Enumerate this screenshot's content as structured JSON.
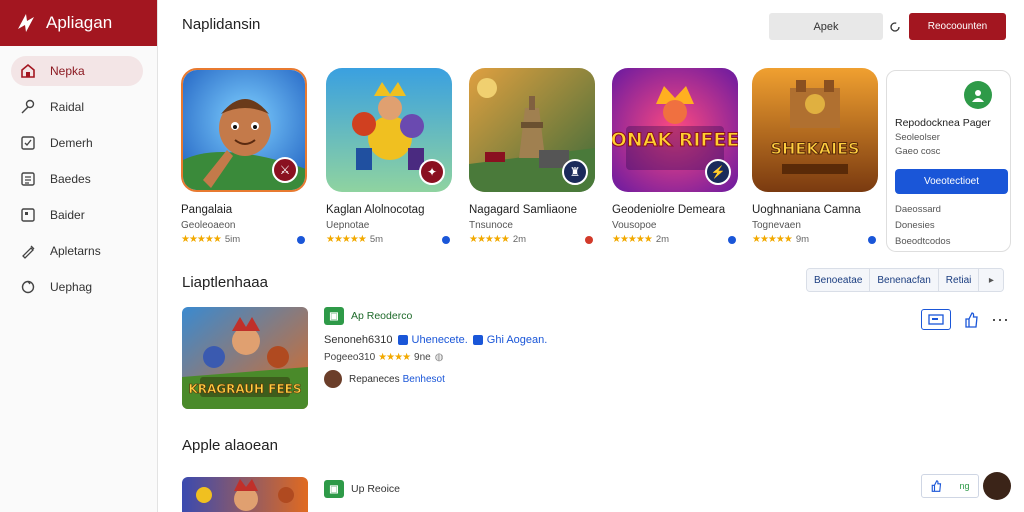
{
  "brand": {
    "name": "Apliagan"
  },
  "sidebar": {
    "items": [
      {
        "label": "Nepka",
        "icon": "home-icon",
        "active": true
      },
      {
        "label": "Raidal",
        "icon": "pin-icon"
      },
      {
        "label": "Demerh",
        "icon": "checklist-icon"
      },
      {
        "label": "Baedes",
        "icon": "list-icon"
      },
      {
        "label": "Baider",
        "icon": "square-icon"
      },
      {
        "label": "Apletarns",
        "icon": "pen-icon"
      },
      {
        "label": "Uephag",
        "icon": "circle-icon"
      }
    ]
  },
  "header": {
    "title": "Naplidansin",
    "grey_button": "Apek",
    "icon": "refresh-icon",
    "red_button": "Reocoounten"
  },
  "apps": [
    {
      "name": "Pangalaia",
      "dev": "Geoleoaeon",
      "rating_text": "5im",
      "stars": 5,
      "dot_color": "#1a56d8",
      "bg1": "#2a7fd6",
      "bg2": "#7fd0ff",
      "art": "#c47a4a",
      "label": ""
    },
    {
      "name": "Kaglan Alolnocotag",
      "dev": "Uepnotae",
      "rating_text": "5m",
      "stars": 5,
      "dot_color": "#1a56d8",
      "bg1": "#3aa0e0",
      "bg2": "#8fd3a0",
      "art": "#f0c020",
      "label": ""
    },
    {
      "name": "Nagagard Samliaone",
      "dev": "Tnsunoce",
      "rating_text": "2m",
      "stars": 5,
      "dot_color": "#d23a2a",
      "bg1": "#3a6a3a",
      "bg2": "#e0a040",
      "art": "#a08050",
      "label": ""
    },
    {
      "name": "Geodeniolre Demeara",
      "dev": "Vousopoe",
      "rating_text": "2m",
      "stars": 5,
      "dot_color": "#1a56d8",
      "bg1": "#6a1aa0",
      "bg2": "#ff4a80",
      "art": "#ffb020",
      "label": "NONAK RIFEEN"
    },
    {
      "name": "Uoghnaniana Camna",
      "dev": "Tognevaen",
      "rating_text": "9m",
      "stars": 5,
      "dot_color": "#1a56d8",
      "bg1": "#7a3a10",
      "bg2": "#f0a030",
      "art": "#e0b040",
      "label": "SHEKAIES"
    }
  ],
  "promo": {
    "title": "Repodocknea Pager",
    "line1": "Seoleolser",
    "line2": "Gaeo cosc",
    "button": "Voeotectioet",
    "small1": "Daeossard",
    "small2": "Donesies",
    "small3": "Boeodtcodos"
  },
  "section1": {
    "title": "Liaptlenhaaa",
    "segments": [
      "Benoeatae",
      "Benenacfan",
      "Retiai"
    ]
  },
  "feature1": {
    "badge": "Ap Reoderco",
    "line2_prefix": "Senoneh6310",
    "tag1": "Uhenecete.",
    "tag2": "Ghi Aogean.",
    "line3_prefix": "Pogeeo310",
    "line3_suffix": "9ne",
    "author": "Repaneces",
    "author_link": "Benhesot",
    "label": "KRAGRAUH FEES"
  },
  "section2": {
    "title": "Apple alaoean"
  },
  "feature2": {
    "badge": "Up Reoice",
    "action_text": "ng"
  }
}
